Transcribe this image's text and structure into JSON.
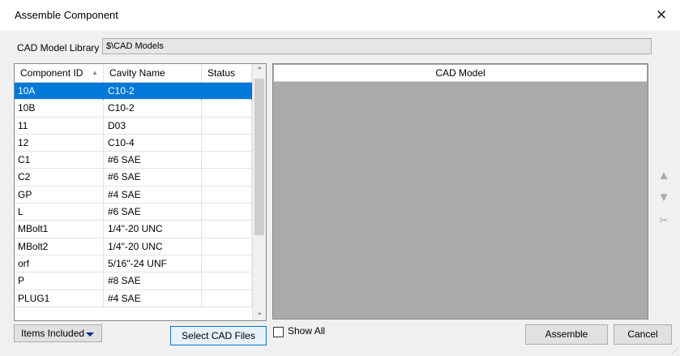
{
  "window": {
    "title": "Assemble Component",
    "close_icon": "close-icon"
  },
  "library": {
    "label": "CAD Model Library",
    "value": "$\\CAD Models"
  },
  "grid": {
    "columns": [
      "Component ID",
      "Cavity Name",
      "Status"
    ],
    "sort_indicator": "sort-ascending-icon",
    "rows": [
      {
        "id": "10A",
        "cavity": "C10-2",
        "status": "",
        "selected": true
      },
      {
        "id": "10B",
        "cavity": "C10-2",
        "status": ""
      },
      {
        "id": "11",
        "cavity": "D03",
        "status": ""
      },
      {
        "id": "12",
        "cavity": "C10-4",
        "status": ""
      },
      {
        "id": "C1",
        "cavity": "#6 SAE",
        "status": ""
      },
      {
        "id": "C2",
        "cavity": "#6 SAE",
        "status": ""
      },
      {
        "id": "GP",
        "cavity": "#4 SAE",
        "status": ""
      },
      {
        "id": "L",
        "cavity": "#6 SAE",
        "status": ""
      },
      {
        "id": "MBolt1",
        "cavity": "1/4\"-20 UNC",
        "status": ""
      },
      {
        "id": "MBolt2",
        "cavity": "1/4\"-20 UNC",
        "status": ""
      },
      {
        "id": "orf",
        "cavity": "5/16\"-24 UNF",
        "status": ""
      },
      {
        "id": "P",
        "cavity": "#8 SAE",
        "status": ""
      },
      {
        "id": "PLUG1",
        "cavity": "#4 SAE",
        "status": ""
      }
    ]
  },
  "cad_panel": {
    "header": "CAD Model"
  },
  "side_buttons": {
    "up_icon": "triangle-up-icon",
    "down_icon": "triangle-down-icon",
    "cut_icon": "scissors-icon"
  },
  "footer": {
    "items_included": "Items Included",
    "select_cad_files": "Select CAD Files",
    "show_all": "Show All",
    "assemble": "Assemble",
    "cancel": "Cancel"
  }
}
